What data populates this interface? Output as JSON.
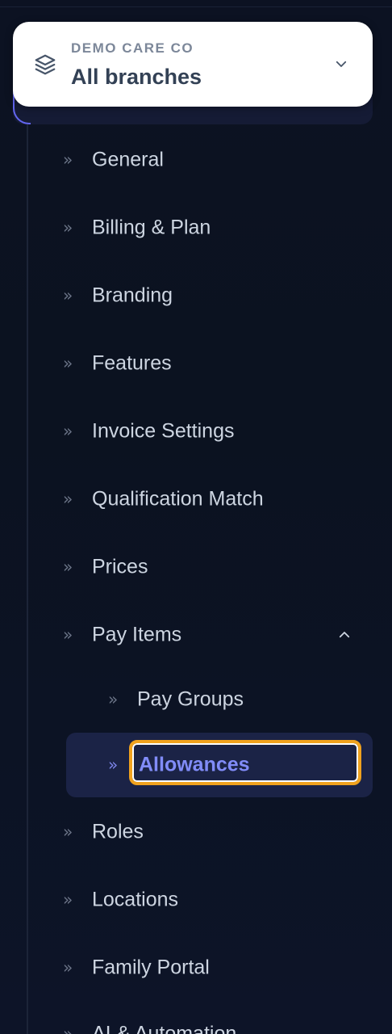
{
  "org": {
    "kicker": "DEMO CARE CO",
    "title": "All branches"
  },
  "nav": {
    "items": [
      {
        "label": "General"
      },
      {
        "label": "Billing & Plan"
      },
      {
        "label": "Branding"
      },
      {
        "label": "Features"
      },
      {
        "label": "Invoice Settings"
      },
      {
        "label": "Qualification Match"
      },
      {
        "label": "Prices"
      },
      {
        "label": "Pay Items"
      },
      {
        "label": "Roles"
      },
      {
        "label": "Locations"
      },
      {
        "label": "Family Portal"
      },
      {
        "label": "AI & Automation"
      }
    ],
    "pay_items_children": [
      {
        "label": "Pay Groups"
      },
      {
        "label": "Allowances"
      }
    ]
  },
  "colors": {
    "background": "#0b1220",
    "active_accent": "#818cf8",
    "focus_outline": "#f0a21e",
    "card": "#ffffff"
  }
}
